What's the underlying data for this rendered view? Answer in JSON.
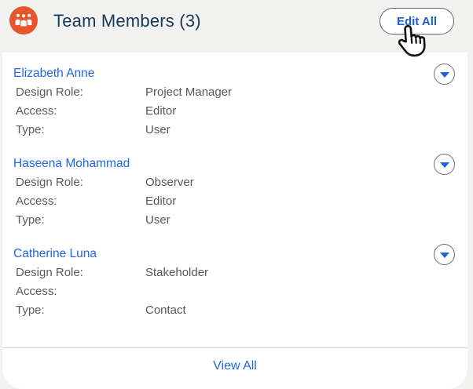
{
  "header": {
    "title": "Team Members (3)",
    "edit_all_label": "Edit All"
  },
  "field_labels": {
    "design_role": "Design Role:",
    "access": "Access:",
    "type": "Type:"
  },
  "members": [
    {
      "name": "Elizabeth Anne",
      "design_role": "Project Manager",
      "access": "Editor",
      "type": "User"
    },
    {
      "name": "Haseena Mohammad",
      "design_role": "Observer",
      "access": "Editor",
      "type": "User"
    },
    {
      "name": "Catherine Luna",
      "design_role": "Stakeholder",
      "access": "",
      "type": "Contact"
    }
  ],
  "footer": {
    "view_all_label": "View All"
  },
  "icons": {
    "header_icon": "team-people-icon",
    "row_icon": "chevron-down-icon",
    "cursor": "hand-pointer-icon"
  },
  "colors": {
    "accent_blue": "#2266E3",
    "link_bold_blue": "#1B5CD7",
    "title_navy": "#17395E",
    "icon_orange": "#E8552D",
    "page_bg": "#F2F2F1",
    "card_bg": "#FFFFFF",
    "label_gray": "#5B5B5B",
    "divider_gray": "#D1D1D1"
  }
}
